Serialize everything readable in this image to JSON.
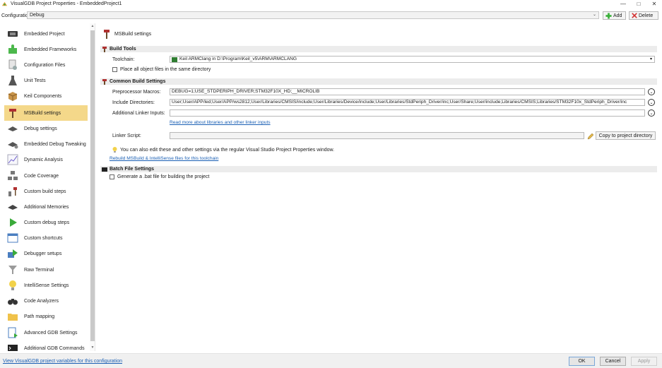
{
  "window": {
    "title": "VisualGDB Project Properties - EmbeddedProject1",
    "controls": {
      "minimize": "—",
      "maximize": "□",
      "close": "✕"
    }
  },
  "config": {
    "label": "Configuration:",
    "value": "Debug",
    "add_label": "Add",
    "delete_label": "Delete"
  },
  "sidebar": {
    "items": [
      {
        "label": "Embedded Project",
        "icon": "chip-board-icon"
      },
      {
        "label": "Embedded Frameworks",
        "icon": "puzzle-icon"
      },
      {
        "label": "Configuration Files",
        "icon": "config-files-icon"
      },
      {
        "label": "Unit Tests",
        "icon": "flask-icon"
      },
      {
        "label": "Keil Components",
        "icon": "box-icon"
      },
      {
        "label": "MSBuild settings",
        "icon": "hammer-icon",
        "active": true
      },
      {
        "label": "Debug settings",
        "icon": "debugger-icon"
      },
      {
        "label": "Embedded Debug Tweaking",
        "icon": "debugger-tweak-icon"
      },
      {
        "label": "Dynamic Analysis",
        "icon": "graph-icon"
      },
      {
        "label": "Code Coverage",
        "icon": "coverage-icon"
      },
      {
        "label": "Custom build steps",
        "icon": "build-steps-icon"
      },
      {
        "label": "Additional Memories",
        "icon": "memory-icon"
      },
      {
        "label": "Custom debug steps",
        "icon": "debug-steps-icon"
      },
      {
        "label": "Custom shortcuts",
        "icon": "shortcuts-icon"
      },
      {
        "label": "Debugger setups",
        "icon": "debugger-setups-icon"
      },
      {
        "label": "Raw Terminal",
        "icon": "terminal-funnel-icon"
      },
      {
        "label": "IntelliSense Settings",
        "icon": "lightbulb-icon"
      },
      {
        "label": "Code Analyzers",
        "icon": "binoculars-icon"
      },
      {
        "label": "Path mapping",
        "icon": "folder-icon"
      },
      {
        "label": "Advanced GDB Settings",
        "icon": "gdb-settings-icon"
      },
      {
        "label": "Additional GDB Commands",
        "icon": "gdb-commands-icon"
      }
    ]
  },
  "main": {
    "page_title": "MSBuild settings",
    "build_tools": {
      "heading": "Build Tools",
      "toolchain_label": "Toolchain:",
      "toolchain_value": "Keil ARMClang in D:\\Program\\Keil_v5\\ARM\\ARMCLANG",
      "same_dir_label": "Place all object files in the same directory"
    },
    "common": {
      "heading": "Common Build Settings",
      "preproc_label": "Preprocessor Macros:",
      "preproc_value": "DEBUG=1;USE_STDPERIPH_DRIVER;STM32F10X_HD;__MICROLIB",
      "include_label": "Include Directories:",
      "include_value": "User;User/APP/led;User/APP/ws2812;User/Libraries/CMSIS/include;User/Libraries/Device/include;User/Libraries/StdPeriph_Driver/inc;User/Share;User/include;Libraries/CMSIS;Libraries/STM32F10x_StdPeriph_Driver/inc",
      "linker_inputs_label": "Additional Linker Inputs:",
      "linker_inputs_value": "",
      "read_more_link": "Read more about libraries and other linker inputs",
      "linker_script_label": "Linker Script:",
      "linker_script_value": "",
      "copy_btn": "Copy to project directory",
      "hint_text": "You can also edit these and other settings via the regular Visual Studio Project Properties window.",
      "rebuild_link": "Rebuild MSBuild & IntelliSense files for this toolchain"
    },
    "batch": {
      "heading": "Batch File Settings",
      "generate_label": "Generate a .bat file for building the project"
    }
  },
  "footer": {
    "vars_link": "View VisualGDB project variables for this configuration",
    "ok": "OK",
    "cancel": "Cancel",
    "apply": "Apply"
  },
  "colors": {
    "active_item": "#f4d88a",
    "link": "#1a5fb4",
    "section_bg": "#ececec"
  }
}
